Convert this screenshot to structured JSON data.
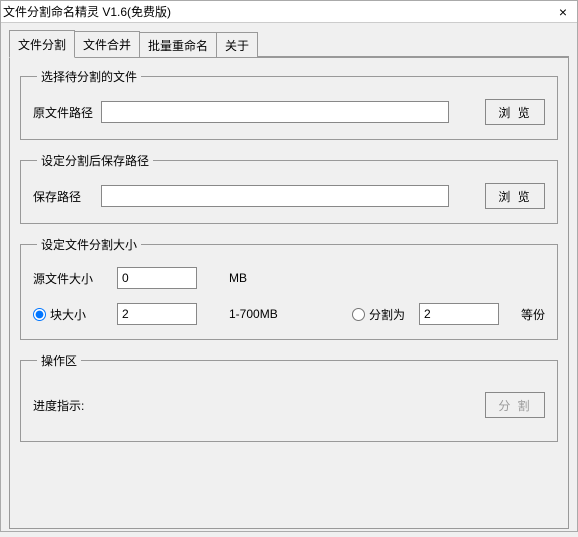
{
  "window": {
    "title": "文件分割命名精灵 V1.6(免费版)",
    "close_icon": "×"
  },
  "tabs": {
    "t1": "文件分割",
    "t2": "文件合并",
    "t3": "批量重命名",
    "t4": "关于"
  },
  "group_select": {
    "legend": "选择待分割的文件",
    "src_path_label": "原文件路径",
    "src_path_value": "",
    "browse": "浏 览"
  },
  "group_save": {
    "legend": "设定分割后保存路径",
    "save_path_label": "保存路径",
    "save_path_value": "",
    "browse": "浏 览"
  },
  "group_size": {
    "legend": "设定文件分割大小",
    "src_size_label": "源文件大小",
    "src_size_value": "0",
    "src_size_unit": "MB",
    "chunk_radio_label": "块大小",
    "chunk_value": "2",
    "chunk_range": "1-700MB",
    "parts_radio_label": "分割为",
    "parts_value": "2",
    "parts_unit": "等份"
  },
  "group_op": {
    "legend": "操作区",
    "progress_label": "进度指示:",
    "split_btn": "分 割"
  }
}
